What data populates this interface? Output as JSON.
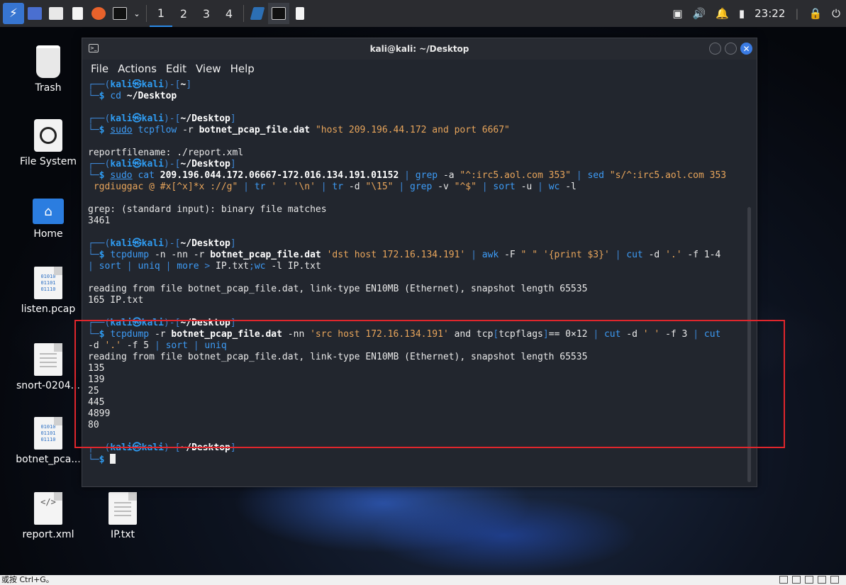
{
  "taskbar": {
    "workspaces": [
      "1",
      "2",
      "3",
      "4"
    ],
    "clock": "23:22"
  },
  "desktop": {
    "icons": [
      {
        "label": "Trash"
      },
      {
        "label": "File System"
      },
      {
        "label": "Home"
      },
      {
        "label": "listen.pcap"
      },
      {
        "label": "snort-0204..."
      },
      {
        "label": "botnet_pca..."
      },
      {
        "label": "report.xml"
      },
      {
        "label": "IP.txt"
      }
    ]
  },
  "terminal": {
    "title": "kali@kali: ~/Desktop",
    "menu": [
      "File",
      "Actions",
      "Edit",
      "View",
      "Help"
    ]
  },
  "statusbar": {
    "text": "或按 Ctrl+G。"
  },
  "colors": {
    "highlight": "#e0262c",
    "accent": "#2f9cf2",
    "string": "#e8a55b"
  }
}
